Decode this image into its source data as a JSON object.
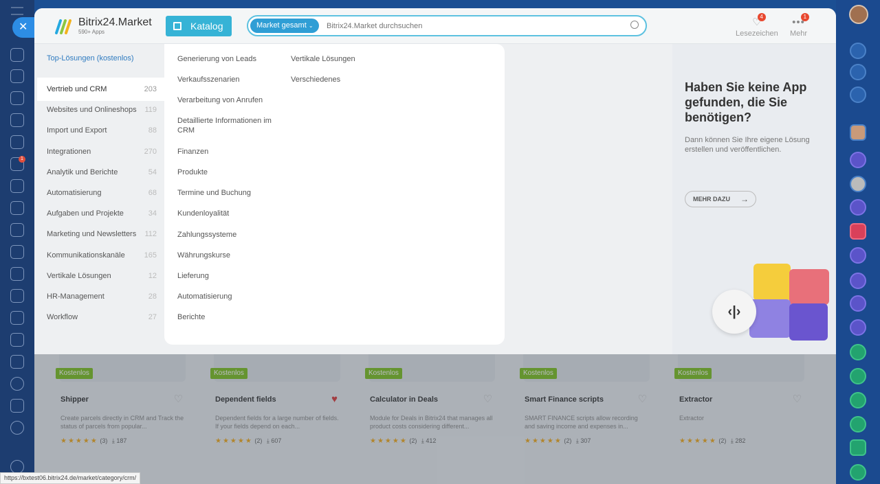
{
  "header": {
    "logo_title": "Bitrix24.Market",
    "logo_sub": "590+ Apps",
    "katalog_label": "Katalog",
    "search_scope": "Market gesamt",
    "search_placeholder": "Bitrix24.Market durchsuchen",
    "bookmarks_label": "Lesezeichen",
    "bookmarks_badge": "4",
    "more_label": "Mehr",
    "more_badge": "1"
  },
  "categories": {
    "top_label": "Top-Lösungen (kostenlos)",
    "items": [
      {
        "label": "Vertrieb und CRM",
        "count": "203"
      },
      {
        "label": "Websites und Onlineshops",
        "count": "119"
      },
      {
        "label": "Import und Export",
        "count": "88"
      },
      {
        "label": "Integrationen",
        "count": "270"
      },
      {
        "label": "Analytik und Berichte",
        "count": "54"
      },
      {
        "label": "Automatisierung",
        "count": "68"
      },
      {
        "label": "Aufgaben und Projekte",
        "count": "34"
      },
      {
        "label": "Marketing und Newsletters",
        "count": "112"
      },
      {
        "label": "Kommunikationskanäle",
        "count": "165"
      },
      {
        "label": "Vertikale Lösungen",
        "count": "12"
      },
      {
        "label": "HR-Management",
        "count": "28"
      },
      {
        "label": "Workflow",
        "count": "27"
      }
    ]
  },
  "subcategories": {
    "col1": [
      "Generierung von Leads",
      "Verkaufsszenarien",
      "Verarbeitung von Anrufen",
      "Detaillierte Informationen im CRM",
      "Finanzen",
      "Produkte",
      "Termine und Buchung",
      "Kundenloyalität",
      "Zahlungssysteme",
      "Währungskurse",
      "Lieferung",
      "Automatisierung",
      "Berichte"
    ],
    "col2": [
      "Vertikale Lösungen",
      "Verschiedenes"
    ]
  },
  "promo": {
    "title": "Haben Sie keine App gefunden, die Sie benötigen?",
    "text": "Dann können Sie Ihre eigene Lösung erstellen und veröffentlichen.",
    "button": "MEHR DAZU"
  },
  "apps": [
    {
      "badge": "Kostenlos",
      "name": "Shipper",
      "desc": "Create parcels directly in CRM and Track the status of parcels from popular...",
      "rating": "(3)",
      "installs": "187",
      "fav": false
    },
    {
      "badge": "Kostenlos",
      "name": "Dependent fields",
      "desc": "Dependent fields for a large number of fields. If your fields depend on each...",
      "rating": "(2)",
      "installs": "607",
      "fav": true
    },
    {
      "badge": "Kostenlos",
      "name": "Calculator in Deals",
      "desc": "Module for Deals in Bitrix24 that manages all product costs considering different...",
      "rating": "(2)",
      "installs": "412",
      "fav": false
    },
    {
      "badge": "Kostenlos",
      "name": "Smart Finance scripts",
      "desc": "SMART FINANCE scripts allow recording and saving income and expenses in...",
      "rating": "(2)",
      "installs": "307",
      "fav": false
    },
    {
      "badge": "Kostenlos",
      "name": "Extractor",
      "desc": "Extractor",
      "rating": "(2)",
      "installs": "282",
      "fav": false
    }
  ],
  "status_url": "https://bxtest06.bitrix24.de/market/category/crm/",
  "colors": {
    "accent": "#36b3d6",
    "search_scope": "#2f9ed5",
    "free_badge": "#7bbf1f",
    "fav_active": "#d93b3b"
  }
}
